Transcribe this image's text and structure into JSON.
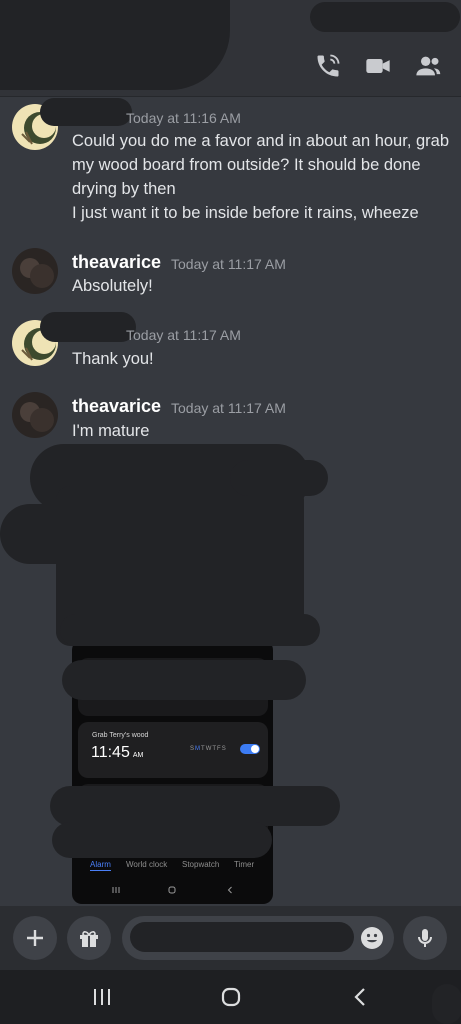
{
  "messages": [
    {
      "author": "",
      "time": "Today at 11:16 AM",
      "lines": [
        "Could you do me a favor and in about an hour, grab",
        "my wood board from outside? It should be done",
        "drying by then",
        "I just want it to be inside before it rains, wheeze"
      ]
    },
    {
      "author": "theavarice",
      "time": "Today at 11:17 AM",
      "lines": [
        "Absolutely!"
      ]
    },
    {
      "author": "",
      "time": "Today at 11:17 AM",
      "lines": [
        "Thank you!"
      ]
    },
    {
      "author": "theavarice",
      "time": "Today at 11:17 AM",
      "lines": [
        "I'm mature"
      ]
    }
  ],
  "clock_app": {
    "alarm_label": "Grab Terry's wood",
    "alarm_time": "11:45",
    "alarm_ampm": "AM",
    "days": [
      "S",
      "M",
      "T",
      "W",
      "T",
      "F",
      "S"
    ],
    "alarm_enabled": true,
    "tabs": [
      "Alarm",
      "World clock",
      "Stopwatch",
      "Timer"
    ],
    "active_tab": "Alarm"
  },
  "icons": {
    "header": [
      "phone-call-icon",
      "video-camera-icon",
      "members-icon"
    ],
    "composer": [
      "plus-icon",
      "gift-icon",
      "emoji-icon",
      "microphone-icon"
    ],
    "system_nav": [
      "recent-apps-icon",
      "home-icon",
      "back-icon"
    ]
  },
  "colors": {
    "background": "#36393f",
    "header": "#313338",
    "accent_blue": "#4a7ff7"
  }
}
